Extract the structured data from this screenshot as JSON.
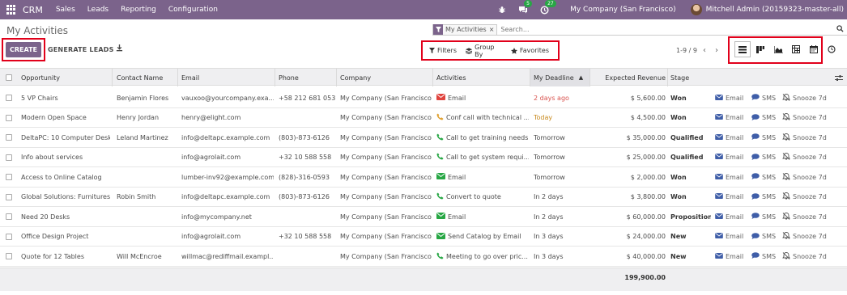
{
  "topbar": {
    "brand": "CRM",
    "menus": [
      "Sales",
      "Leads",
      "Reporting",
      "Configuration"
    ],
    "chat_count": "5",
    "activity_count": "27",
    "company": "My Company (San Francisco)",
    "user": "Mitchell Admin (20159323-master-all)"
  },
  "control": {
    "title": "My Activities",
    "facet": "My Activities",
    "search_placeholder": "Search...",
    "create_label": "CREATE",
    "generate_label": "GENERATE LEADS",
    "filters_label": "Filters",
    "groupby_label": "Group By",
    "favorites_label": "Favorites",
    "pager": "1-9 / 9"
  },
  "table": {
    "columns": {
      "opportunity": "Opportunity",
      "contact": "Contact Name",
      "email": "Email",
      "phone": "Phone",
      "company": "Company",
      "activities": "Activities",
      "deadline": "My Deadline",
      "revenue": "Expected Revenue",
      "stage": "Stage"
    },
    "action_labels": {
      "email": "Email",
      "sms": "SMS",
      "snooze": "Snooze 7d"
    },
    "rows": [
      {
        "opportunity": "5 VP Chairs",
        "contact": "Benjamin Flores",
        "email": "vauxoo@yourcompany.exa...",
        "phone": "+58 212 681 0538",
        "company": "My Company (San Francisco)",
        "activity": "Email",
        "activity_type": "email",
        "activity_color": "#e0443e",
        "deadline": "2 days ago",
        "deadline_state": "overdue",
        "revenue": "$ 5,600.00",
        "stage": "Won"
      },
      {
        "opportunity": "Modern Open Space",
        "contact": "Henry Jordan",
        "email": "henry@elight.com",
        "phone": "",
        "company": "My Company (San Francisco)",
        "activity": "Conf call with technical ...",
        "activity_type": "phone",
        "activity_color": "#e0a02f",
        "deadline": "Today",
        "deadline_state": "today",
        "revenue": "$ 4,500.00",
        "stage": "Won"
      },
      {
        "opportunity": "DeltaPC: 10 Computer Desks",
        "contact": "Leland Martinez",
        "email": "info@deltapc.example.com",
        "phone": "(803)-873-6126",
        "company": "My Company (San Francisco)",
        "activity": "Call to get training needs",
        "activity_type": "phone",
        "activity_color": "#28a745",
        "deadline": "Tomorrow",
        "deadline_state": "planned",
        "revenue": "$ 35,000.00",
        "stage": "Qualified"
      },
      {
        "opportunity": "Info about services",
        "contact": "",
        "email": "info@agrolait.com",
        "phone": "+32 10 588 558",
        "company": "My Company (San Francisco)",
        "activity": "Call to get system requi...",
        "activity_type": "phone",
        "activity_color": "#28a745",
        "deadline": "Tomorrow",
        "deadline_state": "planned",
        "revenue": "$ 25,000.00",
        "stage": "Qualified"
      },
      {
        "opportunity": "Access to Online Catalog",
        "contact": "",
        "email": "lumber-inv92@example.com",
        "phone": "(828)-316-0593",
        "company": "My Company (San Francisco)",
        "activity": "Email",
        "activity_type": "email",
        "activity_color": "#28a745",
        "deadline": "Tomorrow",
        "deadline_state": "planned",
        "revenue": "$ 2,000.00",
        "stage": "Won"
      },
      {
        "opportunity": "Global Solutions: Furnitures",
        "contact": "Robin Smith",
        "email": "info@deltapc.example.com",
        "phone": "(803)-873-6126",
        "company": "My Company (San Francisco)",
        "activity": "Convert to quote",
        "activity_type": "phone",
        "activity_color": "#28a745",
        "deadline": "In 2 days",
        "deadline_state": "planned",
        "revenue": "$ 3,800.00",
        "stage": "Won"
      },
      {
        "opportunity": "Need 20 Desks",
        "contact": "",
        "email": "info@mycompany.net",
        "phone": "",
        "company": "My Company (San Francisco)",
        "activity": "Email",
        "activity_type": "email",
        "activity_color": "#28a745",
        "deadline": "In 2 days",
        "deadline_state": "planned",
        "revenue": "$ 60,000.00",
        "stage": "Proposition"
      },
      {
        "opportunity": "Office Design Project",
        "contact": "",
        "email": "info@agrolait.com",
        "phone": "+32 10 588 558",
        "company": "My Company (San Francisco)",
        "activity": "Send Catalog by Email",
        "activity_type": "email",
        "activity_color": "#28a745",
        "deadline": "In 3 days",
        "deadline_state": "planned",
        "revenue": "$ 24,000.00",
        "stage": "New"
      },
      {
        "opportunity": "Quote for 12 Tables",
        "contact": "Will McEncroe",
        "email": "willmac@rediffmail.exampl...",
        "phone": "",
        "company": "My Company (San Francisco)",
        "activity": "Meeting to go over pric...",
        "activity_type": "phone",
        "activity_color": "#28a745",
        "deadline": "In 3 days",
        "deadline_state": "planned",
        "revenue": "$ 40,000.00",
        "stage": "New"
      }
    ],
    "total_revenue": "199,900.00"
  },
  "colors": {
    "brand": "#7b638b",
    "highlight": "#e1001a",
    "overdue": "#d9534f",
    "today": "#c8891d",
    "action_icon": "#3f5ea8"
  }
}
